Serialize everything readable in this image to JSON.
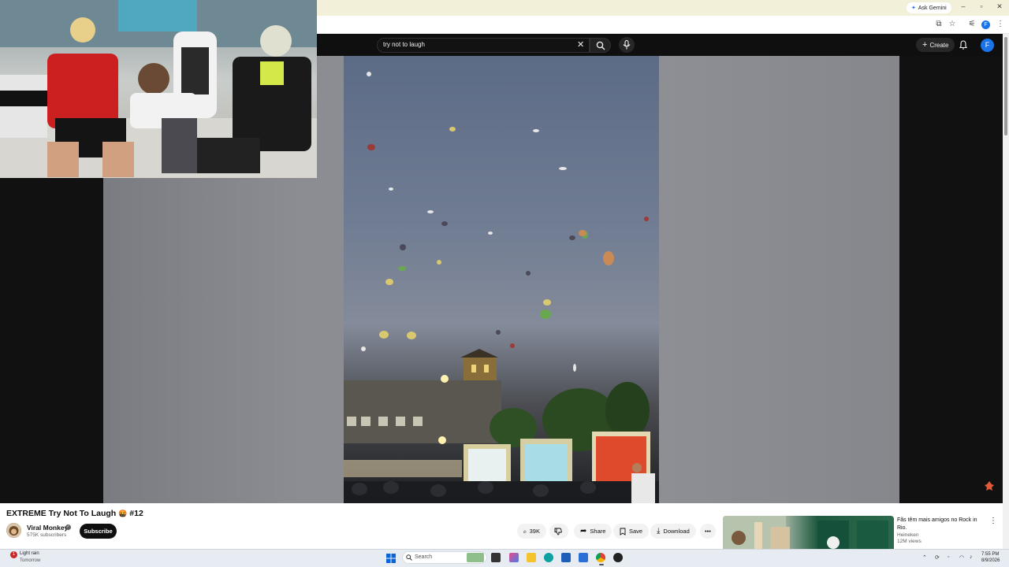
{
  "browser": {
    "gemini_label": "Ask Gemini",
    "profile_initial": "F"
  },
  "header": {
    "search_query": "try not to laugh",
    "create_label": "Create",
    "avatar_initial": "F"
  },
  "video": {
    "title": "EXTREME Try Not To Laugh",
    "title_emoji": "🤬",
    "episode": "#12",
    "channel_name": "Viral Monkey",
    "subscribers": "575K subscribers",
    "subscribe_label": "Subscribe",
    "likes": "39K",
    "share_label": "Share",
    "save_label": "Save",
    "download_label": "Download"
  },
  "recommendation": {
    "title": "Fãs têm mais amigos no Rock in Rio.",
    "channel": "Heineken",
    "views": "12M views"
  },
  "taskbar": {
    "weather_line1": "Light rain",
    "weather_line2": "Tomorrow",
    "weather_badge": "1",
    "search_label": "Search",
    "time": "7:55 PM",
    "date": "8/9/2026"
  },
  "colors": {
    "yt_dark": "#0f0f0f",
    "accent_blue": "#1a73e8",
    "taskbar": "#e7ecf3"
  }
}
